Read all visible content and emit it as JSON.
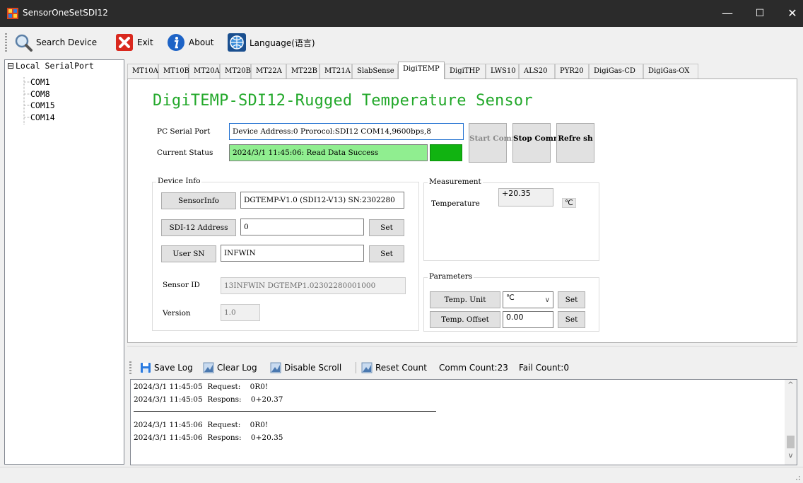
{
  "window": {
    "title": "SensorOneSetSDI12",
    "controls": {
      "minimize": "—",
      "maximize": "☐",
      "close": "✕"
    }
  },
  "toolbar": {
    "search_label": "Search Device",
    "exit_label": "Exit",
    "about_label": "About",
    "language_label": "Language(语言)"
  },
  "tree": {
    "root": "Local SerialPort",
    "expander": "⊟",
    "ports": [
      "COM1",
      "COM8",
      "COM15",
      "COM14"
    ]
  },
  "tabs": [
    "MT10A",
    "MT10B",
    "MT20A",
    "MT20B",
    "MT22A",
    "MT22B",
    "MT21A",
    "SlabSense",
    "DigiTEMP",
    "DigiTHP",
    "LWS10",
    "ALS20",
    "PYR20",
    "DigiGas-CD",
    "DigiGas-OX"
  ],
  "active_tab": "DigiTEMP",
  "device": {
    "title": "DigiTEMP-SDI12-Rugged Temperature Sensor",
    "pc_serial_port_label": "PC Serial Port",
    "pc_serial_port_value": "Device Address:0 Prorocol:SDI12 COM14,9600bps,8",
    "current_status_label": "Current Status",
    "current_status_value": "2024/3/1 11:45:06: Read Data Success",
    "status_indicator_color": "#11b311",
    "start_comm": "Start Comm",
    "stop_comm": "Stop Comm",
    "refresh": "Refre sh"
  },
  "device_info": {
    "group_title": "Device Info",
    "sensorinfo_button": "SensorInfo",
    "sensorinfo_value": "DGTEMP-V1.0 (SDI12-V13) SN:2302280",
    "sdi12_address_button": "SDI-12 Address",
    "sdi12_address_value": "0",
    "set_label": "Set",
    "user_sn_button": "User SN",
    "user_sn_value": "INFWIN",
    "sensor_id_label": "Sensor ID",
    "sensor_id_value": "13INFWIN  DGTEMP1.02302280001000",
    "version_label": "Version",
    "version_value": "1.0"
  },
  "measurement": {
    "group_title": "Measurement",
    "temperature_label": "Temperature",
    "temperature_value": "+20.35",
    "unit": "℃"
  },
  "parameters": {
    "group_title": "Parameters",
    "temp_unit_button": "Temp. Unit",
    "temp_unit_value": "℃",
    "temp_offset_button": "Temp. Offset",
    "temp_offset_value": "0.00",
    "set_label": "Set"
  },
  "log": {
    "save_log": "Save Log",
    "clear_log": "Clear Log",
    "disable_scroll": "Disable Scroll",
    "reset_count": "Reset Count",
    "comm_count": "Comm Count:23",
    "fail_count": "Fail Count:0",
    "lines": [
      "2024/3/1 11:45:05  Request:    0R0!",
      "2024/3/1 11:45:05  Respons:    0+20.37",
      "2024/3/1 11:45:06  Request:    0R0!",
      "2024/3/1 11:45:06  Respons:    0+20.35"
    ]
  }
}
